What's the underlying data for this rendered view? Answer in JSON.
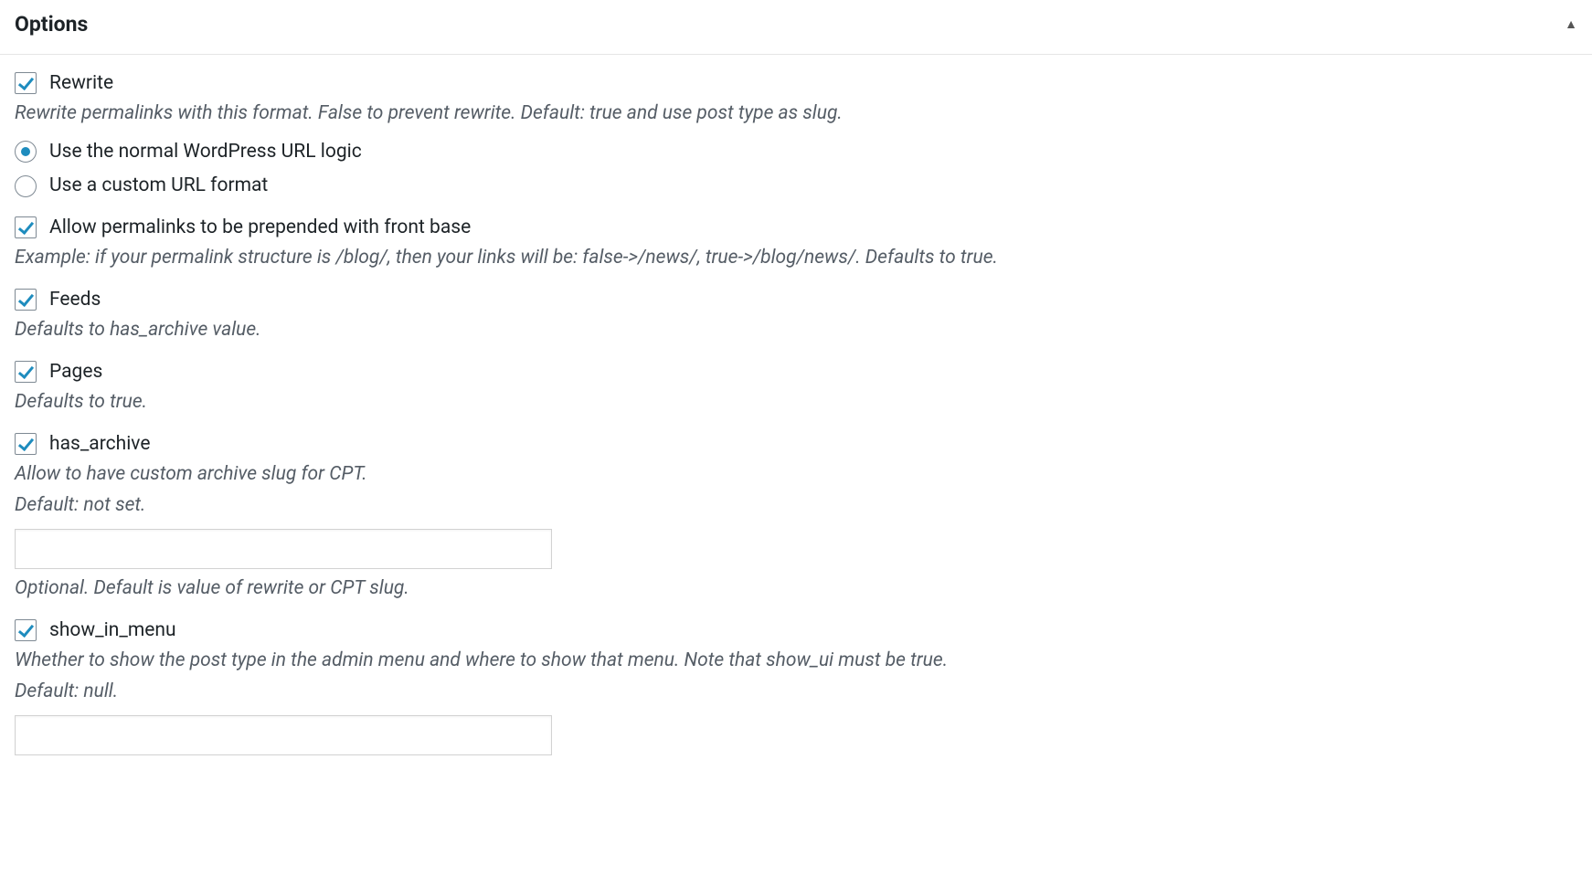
{
  "panel": {
    "title": "Options",
    "fields": {
      "rewrite": {
        "label": "Rewrite",
        "desc": "Rewrite permalinks with this format. False to prevent rewrite. Default: true and use post type as slug.",
        "checked": true
      },
      "url_logic": {
        "options": {
          "normal": "Use the normal WordPress URL logic",
          "custom": "Use a custom URL format"
        },
        "selected": "normal"
      },
      "front_base": {
        "label": "Allow permalinks to be prepended with front base",
        "desc": "Example: if your permalink structure is /blog/, then your links will be: false->/news/, true->/blog/news/. Defaults to true.",
        "checked": true
      },
      "feeds": {
        "label": "Feeds",
        "desc": "Defaults to has_archive value.",
        "checked": true
      },
      "pages": {
        "label": "Pages",
        "desc": "Defaults to true.",
        "checked": true
      },
      "has_archive": {
        "label": "has_archive",
        "desc1": "Allow to have custom archive slug for CPT.",
        "desc2": "Default: not set.",
        "value": "",
        "input_desc": "Optional. Default is value of rewrite or CPT slug.",
        "checked": true
      },
      "show_in_menu": {
        "label": "show_in_menu",
        "desc1": "Whether to show the post type in the admin menu and where to show that menu. Note that show_ui must be true.",
        "desc2": "Default: null.",
        "value": "",
        "checked": true
      }
    }
  }
}
